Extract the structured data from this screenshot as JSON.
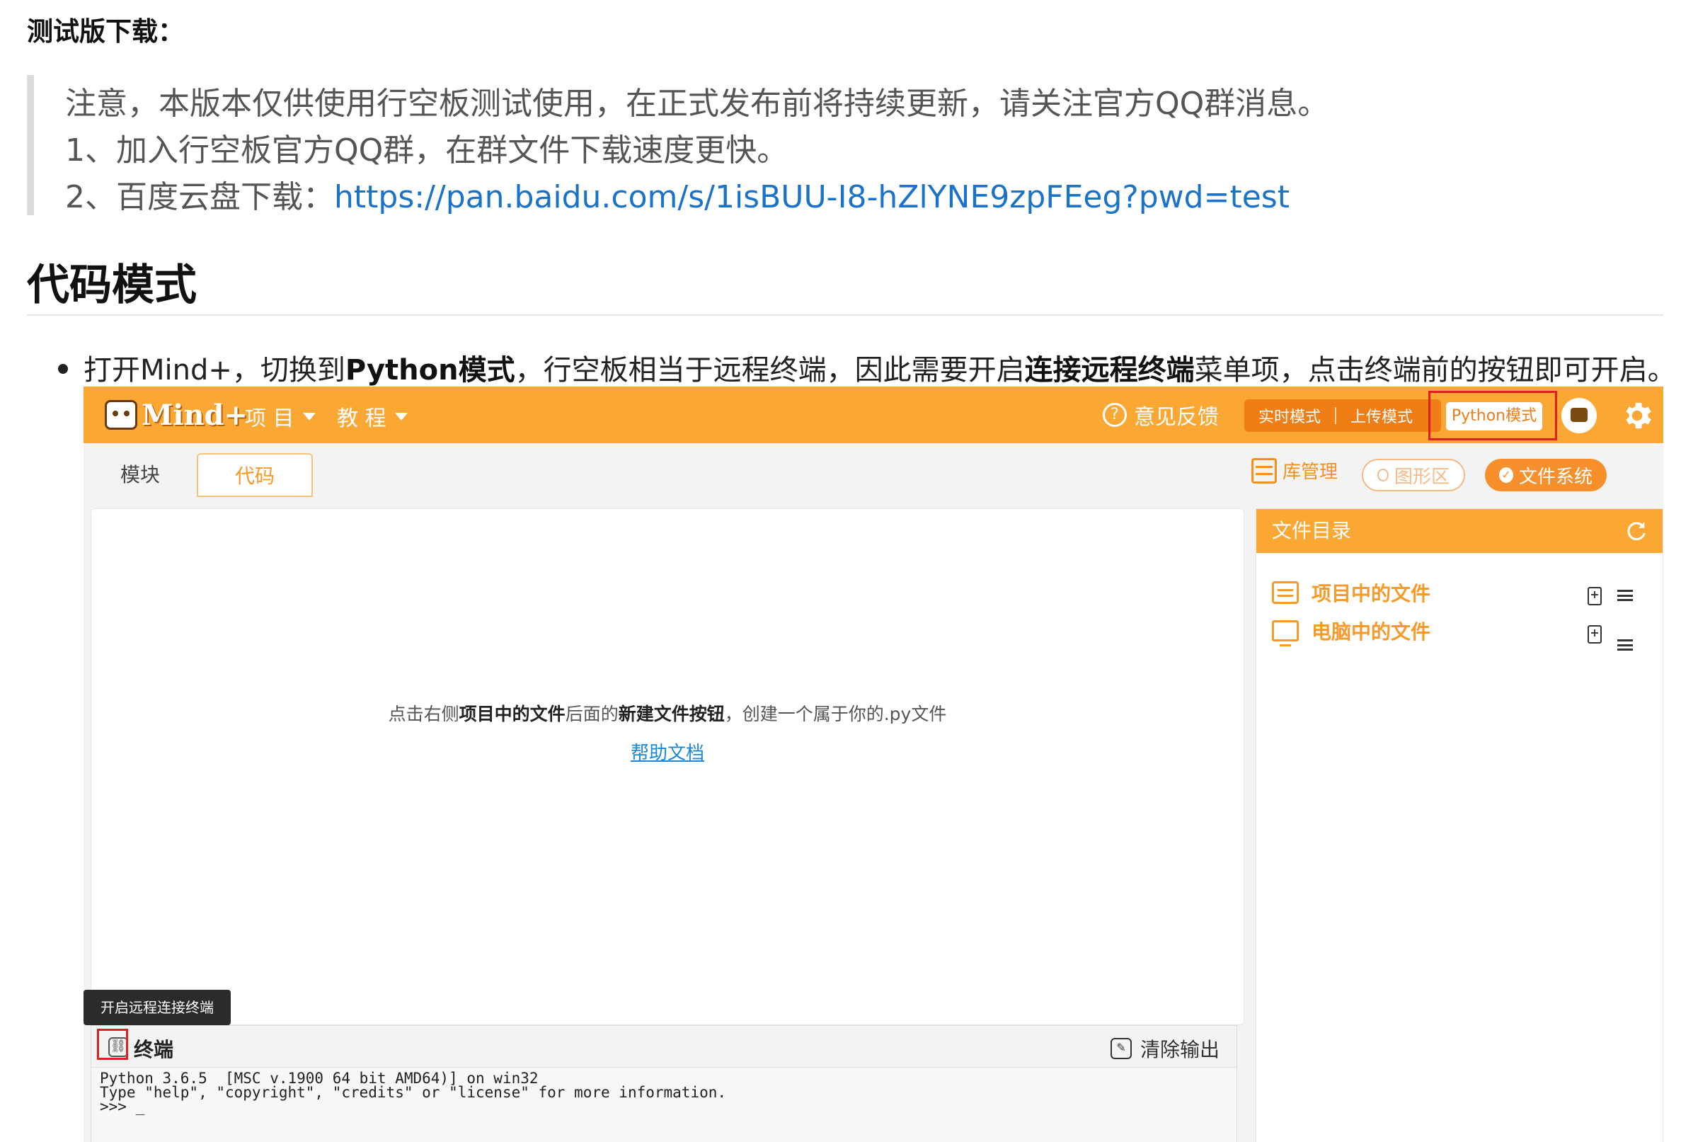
{
  "doc": {
    "download_heading": "测试版下载：",
    "notice": "注意，本版本仅供使用行空板测试使用，在正式发布前将持续更新，请关注官方QQ群消息。",
    "item1": "1、加入行空板官方QQ群，在群文件下载速度更快。",
    "item2_prefix": "2、百度云盘下载：",
    "item2_link": "https://pan.baidu.com/s/1isBUU-I8-hZlYNE9zpFEeg?pwd=test",
    "section_title": "代码模式",
    "bullet": {
      "t1": "打开Mind+，切换到",
      "b1": "Python模式",
      "t2": "，行空板相当于远程终端，因此需要开启",
      "b2": "连接远程终端",
      "t3": "菜单项，点击终端前的按钮即可开启。"
    }
  },
  "app": {
    "logo_text": "Mind+",
    "menu_project": "项 目",
    "menu_tutorial": "教 程",
    "feedback": "意见反馈",
    "mode_realtime": "实时模式",
    "mode_upload": "上传模式",
    "mode_python": "Python模式",
    "tab_blocks": "模块",
    "tab_code": "代码",
    "lib_manage": "库管理",
    "graph_area": "图形区",
    "file_system": "文件系统",
    "editor_hint": {
      "p1": "点击右侧",
      "b1": "项目中的文件",
      "p2": "后面的",
      "b2": "新建文件按钮",
      "p3": "，创建一个属于你的.py文件"
    },
    "help_doc": "帮助文档",
    "file_dir_title": "文件目录",
    "project_files": "项目中的文件",
    "computer_files": "电脑中的文件",
    "tooltip": "开启远程连接终端",
    "terminal_title": "终端",
    "clear_output": "清除输出",
    "terminal_lines": [
      "Python 3.6.5  [MSC v.1900 64 bit AMD64)] on win32",
      "Type \"help\", \"copyright\", \"credits\" or \"license\" for more information.",
      ">>> _"
    ]
  },
  "colors": {
    "accent_orange": "#fba733",
    "link_blue": "#1a73c8",
    "highlight_red": "#e02020"
  },
  "icons": [
    "help-circle-icon",
    "robot-icon",
    "gear-icon",
    "library-icon",
    "graph-dot-icon",
    "check-icon",
    "refresh-icon",
    "file-list-icon",
    "computer-icon",
    "new-file-icon",
    "menu-icon",
    "link-icon",
    "brush-icon"
  ]
}
